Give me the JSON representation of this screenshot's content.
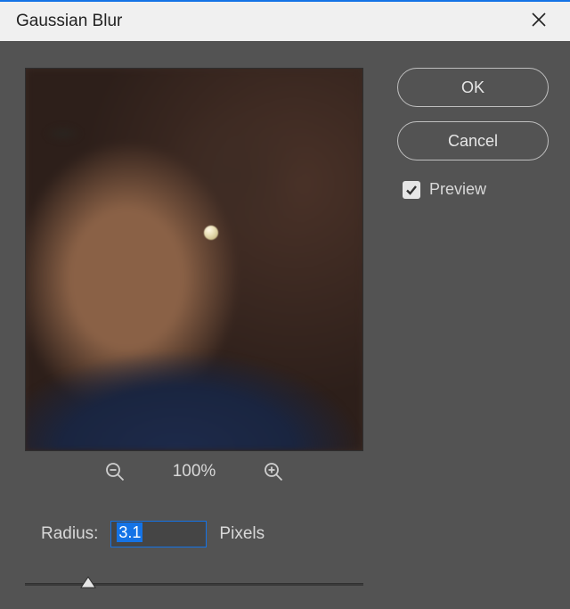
{
  "dialog": {
    "title": "Gaussian Blur"
  },
  "buttons": {
    "ok": "OK",
    "cancel": "Cancel"
  },
  "preview": {
    "label": "Preview",
    "checked": true
  },
  "zoom": {
    "level": "100%"
  },
  "radius": {
    "label": "Radius:",
    "value": "3.1",
    "unit": "Pixels",
    "slider_min": 0.1,
    "slider_max": 1000,
    "slider_pos_percent": 17
  },
  "icons": {
    "close": "close-icon",
    "zoom_out": "zoom-out-icon",
    "zoom_in": "zoom-in-icon",
    "checkmark": "checkmark-icon"
  }
}
